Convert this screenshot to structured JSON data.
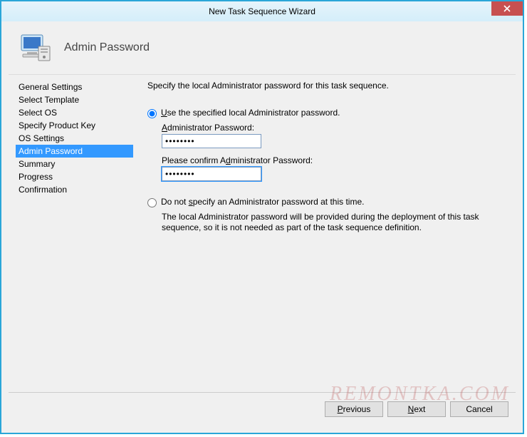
{
  "window": {
    "title": "New Task Sequence Wizard",
    "close": "✕"
  },
  "header": {
    "heading": "Admin Password"
  },
  "sidebar": {
    "items": [
      {
        "label": "General Settings",
        "selected": false
      },
      {
        "label": "Select Template",
        "selected": false
      },
      {
        "label": "Select OS",
        "selected": false
      },
      {
        "label": "Specify Product Key",
        "selected": false
      },
      {
        "label": "OS Settings",
        "selected": false
      },
      {
        "label": "Admin Password",
        "selected": true
      },
      {
        "label": "Summary",
        "selected": false
      },
      {
        "label": "Progress",
        "selected": false
      },
      {
        "label": "Confirmation",
        "selected": false
      }
    ]
  },
  "content": {
    "instruction": "Specify the local Administrator password for this task sequence.",
    "option1": {
      "pre": "",
      "u": "U",
      "post": "se the specified local Administrator password.",
      "pwd_label_pre": "",
      "pwd_label_u": "A",
      "pwd_label_post": "dministrator Password:",
      "pwd_value": "••••••••",
      "confirm_label_pre": "Please confirm A",
      "confirm_label_u": "d",
      "confirm_label_post": "ministrator Password:",
      "confirm_value": "••••••••"
    },
    "option2": {
      "pre": "Do not ",
      "u": "s",
      "post": "pecify an Administrator password at this time.",
      "note": "The local Administrator password will be provided during the deployment of this task sequence, so it is not needed as part of the task sequence definition."
    },
    "selected_option": "option1"
  },
  "footer": {
    "previous": {
      "u": "P",
      "rest": "revious"
    },
    "next": {
      "u": "N",
      "rest": "ext"
    },
    "cancel": {
      "label": "Cancel"
    }
  },
  "watermark": "REMONTKA.COM"
}
